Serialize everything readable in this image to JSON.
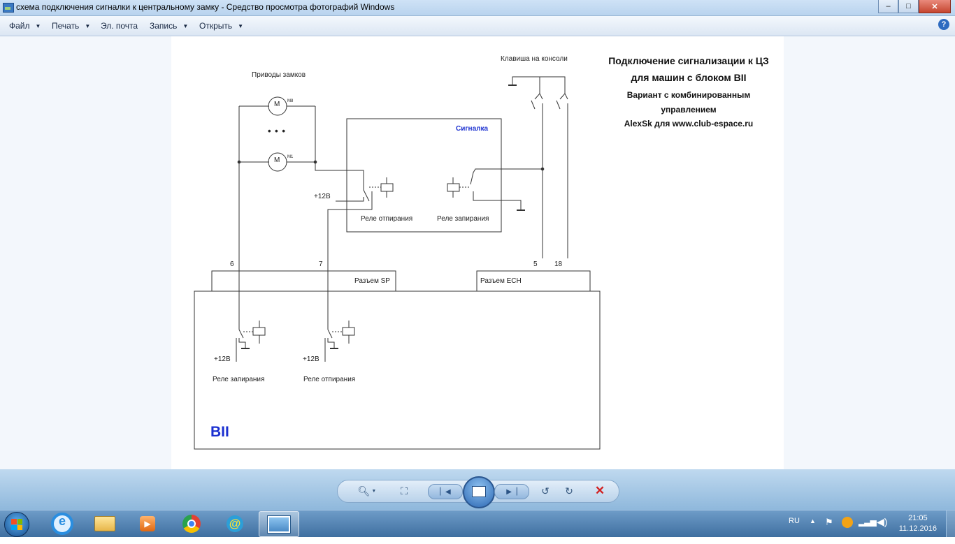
{
  "window": {
    "title": "схема подключения сигналки к центральному замку - Средство просмотра фотографий Windows",
    "controls": {
      "minimize": "–",
      "maximize": "□",
      "close": "✕"
    }
  },
  "menu": {
    "file": "Файл",
    "print": "Печать",
    "email": "Эл. почта",
    "burn": "Запись",
    "open": "Открыть",
    "help_icon": "?"
  },
  "diagram": {
    "lock_drives": "Приводы замков",
    "motor_label": "M",
    "m8": "M8",
    "m1": "M1",
    "ellipsis": "• • •",
    "console_key": "Клавиша на консоли",
    "title_line1": "Подключение сигнализации к ЦЗ",
    "title_line2": "для машин с блоком BII",
    "variant_line1": "Вариант с комбинированным",
    "variant_line2": "управлением",
    "author": "AlexSk для www.club-espace.ru",
    "alarm": "Сигналка",
    "plus12v": "+12В",
    "relay_unlock": "Реле отпирания",
    "relay_lock": "Реле запирания",
    "pin6": "6",
    "pin7": "7",
    "pin5": "5",
    "pin18": "18",
    "connector_sp": "Разъем SP",
    "connector_ech": "Разъем ECH",
    "block": "BII"
  },
  "viewer_controls": {
    "zoom_icon": "zoom-icon",
    "fit_icon": "fit-window-icon",
    "prev_icon": "previous-icon",
    "slideshow_icon": "slideshow-icon",
    "next_icon": "next-icon",
    "rotate_ccw_icon": "rotate-counterclockwise-icon",
    "rotate_cw_icon": "rotate-clockwise-icon",
    "delete_icon": "delete-icon"
  },
  "taskbar": {
    "language": "RU",
    "time": "21:05",
    "date": "11.12.2016"
  },
  "colors": {
    "alarm_label": "#1a2fd0",
    "block_label": "#1a2fd0",
    "delete": "#d21f1f"
  }
}
